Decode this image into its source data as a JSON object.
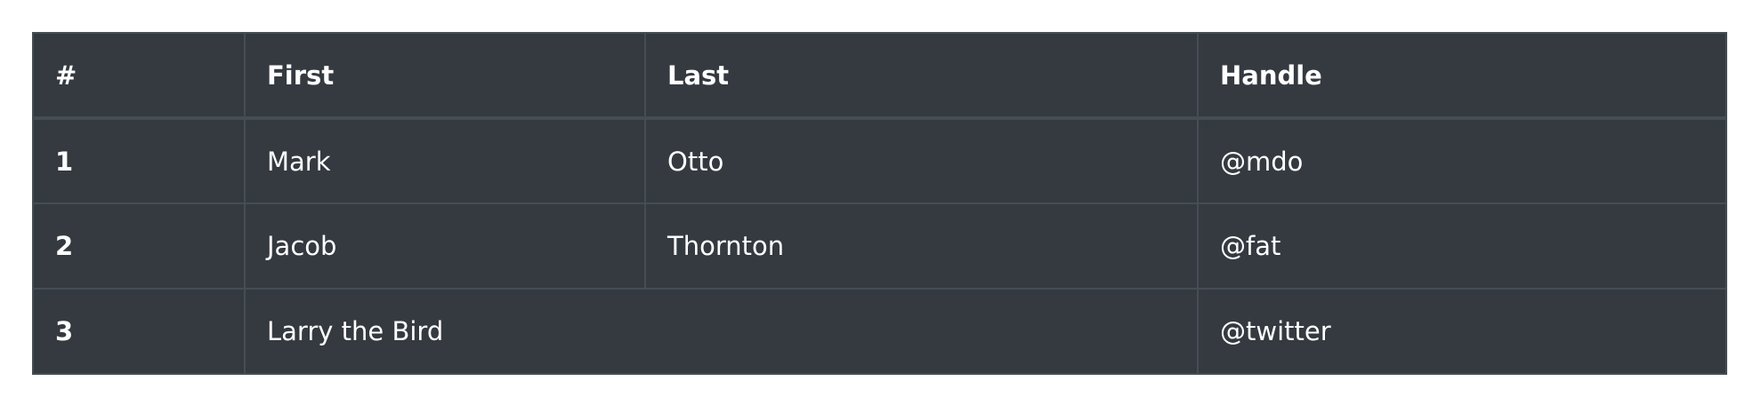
{
  "table": {
    "headers": [
      "#",
      "First",
      "Last",
      "Handle"
    ],
    "rows": [
      {
        "num": "1",
        "first": "Mark",
        "last": "Otto",
        "handle": "@mdo"
      },
      {
        "num": "2",
        "first": "Jacob",
        "last": "Thornton",
        "handle": "@fat"
      },
      {
        "num": "3",
        "name": "Larry the Bird",
        "handle": "@twitter"
      }
    ],
    "colors": {
      "background": "#343a40",
      "border": "#454d55",
      "text": "#ffffff"
    }
  }
}
